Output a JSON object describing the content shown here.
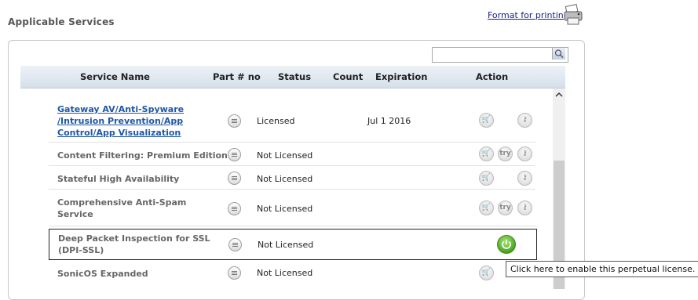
{
  "heading": "Applicable Services",
  "print_link": "Format for printing",
  "search": {
    "value": "",
    "placeholder": ""
  },
  "columns": {
    "service_name": "Service Name",
    "part_no": "Part # no",
    "status": "Status",
    "count": "Count",
    "expiration": "Expiration",
    "action": "Action"
  },
  "rows": [
    {
      "line1": "Gateway AV/Anti-Spyware",
      "line2": "/Intrusion Prevention/App",
      "line3": "Control/App Visualization",
      "status": "Licensed",
      "expiration": "Jul 1 2016",
      "actions": [
        "cart-icon",
        "key-icon"
      ]
    },
    {
      "line1": "Content Filtering: Premium Edition",
      "status": "Not Licensed",
      "actions": [
        "cart-icon",
        "try-icon",
        "key-icon"
      ],
      "try_label": "try"
    },
    {
      "line1": "Stateful High Availability",
      "status": "Not Licensed",
      "actions": [
        "cart-icon",
        "key-icon"
      ]
    },
    {
      "line1": "Comprehensive Anti-Spam",
      "line2": "Service",
      "status": "Not Licensed",
      "actions": [
        "cart-icon",
        "try-icon",
        "key-icon"
      ],
      "try_label": "try"
    },
    {
      "line1": "Deep Packet Inspection for SSL",
      "line2": "(DPI-SSL)",
      "status": "Not Licensed",
      "actions": [
        "power-icon"
      ]
    },
    {
      "line1": "SonicOS Expanded",
      "status": "Not Licensed",
      "actions": [
        "cart-icon"
      ]
    }
  ],
  "tooltip": "Click here to enable this perpetual license.",
  "colors": {
    "link": "#1f57a6",
    "enable_green": "#4aa323"
  }
}
